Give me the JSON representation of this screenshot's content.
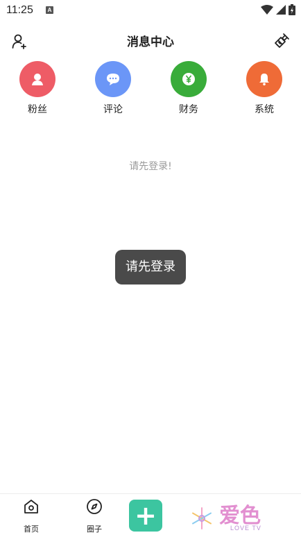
{
  "status_bar": {
    "time": "11:25",
    "notification_letter": "A"
  },
  "header": {
    "title": "消息中心"
  },
  "categories": [
    {
      "label": "粉丝",
      "color": "#ee5c66",
      "icon": "user-icon"
    },
    {
      "label": "评论",
      "color": "#6b96f7",
      "icon": "comment-icon"
    },
    {
      "label": "财务",
      "color": "#39ac3a",
      "icon": "yen-icon"
    },
    {
      "label": "系统",
      "color": "#ef6b37",
      "icon": "bell-icon"
    }
  ],
  "empty_message": "请先登录!",
  "toast": "请先登录",
  "tabbar": {
    "tabs": [
      {
        "label": "首页",
        "icon": "home-icon"
      },
      {
        "label": "圈子",
        "icon": "compass-icon"
      }
    ],
    "add_symbol": "+",
    "add_color": "#3cc5a0"
  },
  "watermark": {
    "brand": "爱色",
    "tagline": "LOVE TV"
  }
}
